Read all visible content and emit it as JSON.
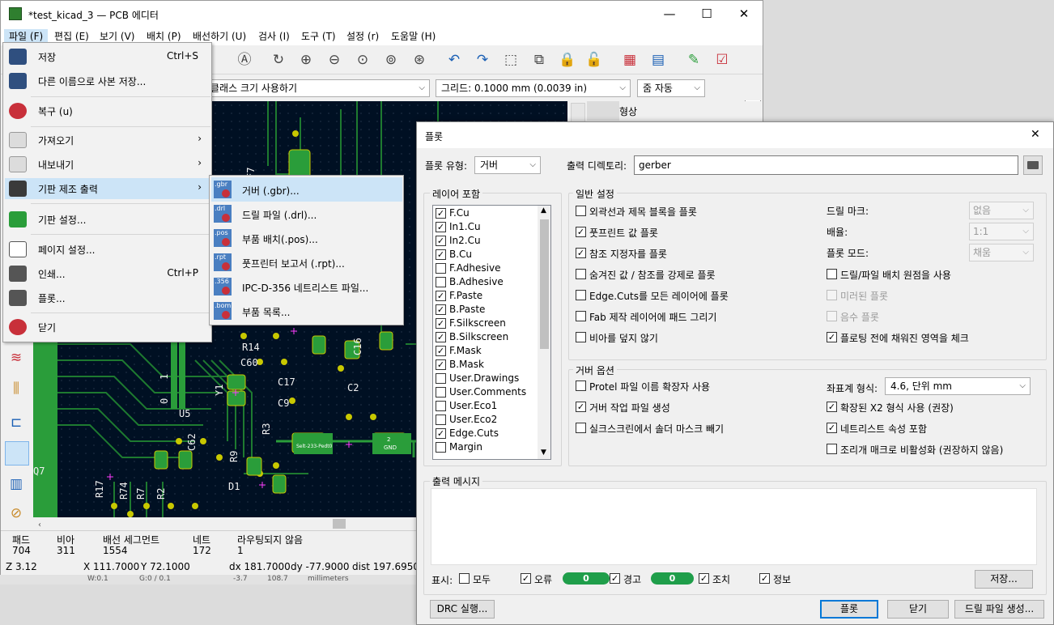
{
  "window": {
    "title": "*test_kicad_3 — PCB 에디터",
    "minimize": "—",
    "maximize": "☐",
    "close": "✕"
  },
  "menubar": [
    "파일 (F)",
    "편집 (E)",
    "보기 (V)",
    "배치 (P)",
    "배선하기 (U)",
    "검사 (I)",
    "도구 (T)",
    "설정 (r)",
    "도움말 (H)"
  ],
  "toolbar2": {
    "track_combo": "트랙: 네트클래스 크기 사용하기",
    "grid_combo": "그리드: 0.1000 mm (0.0039 in)",
    "zoom_combo": "줌 자동"
  },
  "right_panel_title": "형상",
  "file_menu": {
    "save": "저장",
    "save_shortcut": "Ctrl+S",
    "save_copy": "다른 이름으로 사본 저장...",
    "revert": "복구 (u)",
    "import": "가져오기",
    "export": "내보내기",
    "fabrication": "기판 제조 출력",
    "board_setup": "기판 설정...",
    "page_setup": "페이지 설정...",
    "print": "인쇄...",
    "print_shortcut": "Ctrl+P",
    "plot": "플롯...",
    "close": "닫기",
    "submenu_arrow": "›"
  },
  "fab_submenu": [
    {
      "ext": ".gbr",
      "label": "거버 (.gbr)..."
    },
    {
      "ext": ".drl",
      "label": "드릴 파일 (.drl)..."
    },
    {
      "ext": ".pos",
      "label": "부품 배치(.pos)..."
    },
    {
      "ext": ".rpt",
      "label": "풋프린터 보고서 (.rpt)..."
    },
    {
      "ext": ".356",
      "label": "IPC-D-356 네트리스트 파일..."
    },
    {
      "ext": ".bom",
      "label": "부품 목록..."
    }
  ],
  "pcb_labels": [
    "R14",
    "C60",
    "C17",
    "C9",
    "C16",
    "C2",
    "U5",
    "C62",
    "R3",
    "R9",
    "D1",
    "Q7",
    "R17",
    "R74",
    "R7",
    "R2",
    "Y1",
    "F7",
    "0",
    "1",
    "GND",
    "2"
  ],
  "pcb_pad_text": "Selt-233-Pedt0",
  "status": {
    "headers": [
      "패드",
      "비아",
      "배선 세그먼트",
      "네트",
      "라우팅되지 않음"
    ],
    "values": [
      "704",
      "311",
      "1554",
      "172",
      "1"
    ],
    "z": "Z 3.12",
    "x": "X 111.7000",
    "y": "Y 72.1000",
    "dx": "dx 181.7000",
    "dy": "dy -77.9000",
    "dist": "dist 197.6950",
    "under": [
      "W:0.1",
      "G:0 / 0.1",
      "-3.7",
      "108.7",
      "millimeters"
    ]
  },
  "plot_dialog": {
    "title": "플롯",
    "close": "✕",
    "plot_format_label": "플롯 유형:",
    "plot_format_value": "거버",
    "output_dir_label": "출력 디렉토리:",
    "output_dir_value": "gerber",
    "layers_title": "레이어 포함",
    "layers": [
      {
        "name": "F.Cu",
        "checked": true
      },
      {
        "name": "In1.Cu",
        "checked": true
      },
      {
        "name": "In2.Cu",
        "checked": true
      },
      {
        "name": "B.Cu",
        "checked": true
      },
      {
        "name": "F.Adhesive",
        "checked": false
      },
      {
        "name": "B.Adhesive",
        "checked": false
      },
      {
        "name": "F.Paste",
        "checked": true
      },
      {
        "name": "B.Paste",
        "checked": true
      },
      {
        "name": "F.Silkscreen",
        "checked": true
      },
      {
        "name": "B.Silkscreen",
        "checked": true
      },
      {
        "name": "F.Mask",
        "checked": true
      },
      {
        "name": "B.Mask",
        "checked": true
      },
      {
        "name": "User.Drawings",
        "checked": false
      },
      {
        "name": "User.Comments",
        "checked": false
      },
      {
        "name": "User.Eco1",
        "checked": false
      },
      {
        "name": "User.Eco2",
        "checked": false
      },
      {
        "name": "Edge.Cuts",
        "checked": true
      },
      {
        "name": "Margin",
        "checked": false
      }
    ],
    "general_title": "일반 설정",
    "general_options": [
      {
        "label": "외곽선과 제목 블록을 플롯",
        "checked": false
      },
      {
        "label": "풋프린트 값 플롯",
        "checked": true
      },
      {
        "label": "참조 지정자를 플롯",
        "checked": true
      },
      {
        "label": "숨겨진 값 / 참조를 강제로 플롯",
        "checked": false
      },
      {
        "label": "Edge.Cuts를 모든 레이어에 플롯",
        "checked": false
      },
      {
        "label": "Fab 제작 레이어에 패드 그리기",
        "checked": false
      },
      {
        "label": "비아를 덮지 않기",
        "checked": false
      }
    ],
    "drill_marks_label": "드릴 마크:",
    "drill_marks_value": "없음",
    "scale_label": "배율:",
    "scale_value": "1:1",
    "plot_mode_label": "플롯 모드:",
    "plot_mode_value": "채움",
    "right_options": [
      {
        "label": "드릴/파일 배치 원점을 사용",
        "checked": false,
        "disabled": false
      },
      {
        "label": "미러된 플롯",
        "checked": false,
        "disabled": true
      },
      {
        "label": "음수 플롯",
        "checked": false,
        "disabled": true
      },
      {
        "label": "플로팅 전에 채워진 영역을 체크",
        "checked": true,
        "disabled": false
      }
    ],
    "gerber_title": "거버 옵션",
    "gerber_left": [
      {
        "label": "Protel 파일 이름 확장자 사용",
        "checked": false
      },
      {
        "label": "거버 작업 파일 생성",
        "checked": true
      },
      {
        "label": "실크스크린에서 솔더 마스크 빼기",
        "checked": false
      }
    ],
    "coord_format_label": "좌표계 형식:",
    "coord_format_value": "4.6, 단위 mm",
    "gerber_right": [
      {
        "label": "확장된 X2 형식 사용 (권장)",
        "checked": true
      },
      {
        "label": "네트리스트 속성 포함",
        "checked": true
      },
      {
        "label": "조리개 매크로 비활성화 (권장하지 않음)",
        "checked": false
      }
    ],
    "messages_title": "출력 메시지",
    "show_label": "표시:",
    "filter_all": "모두",
    "filter_errors": "오류",
    "filter_warnings": "경고",
    "filter_actions": "조치",
    "filter_info": "정보",
    "error_count": "0",
    "warning_count": "0",
    "save_button": "저장...",
    "drc_button": "DRC 실행...",
    "plot_button": "플롯",
    "close_button": "닫기",
    "drill_button": "드릴 파일 생성..."
  },
  "colors": {
    "pcb_bg": "#001023",
    "copper": "#2a9d3a",
    "pad": "#c8c800",
    "selection": "#cce4f7",
    "pill": "#1f9e4a"
  }
}
